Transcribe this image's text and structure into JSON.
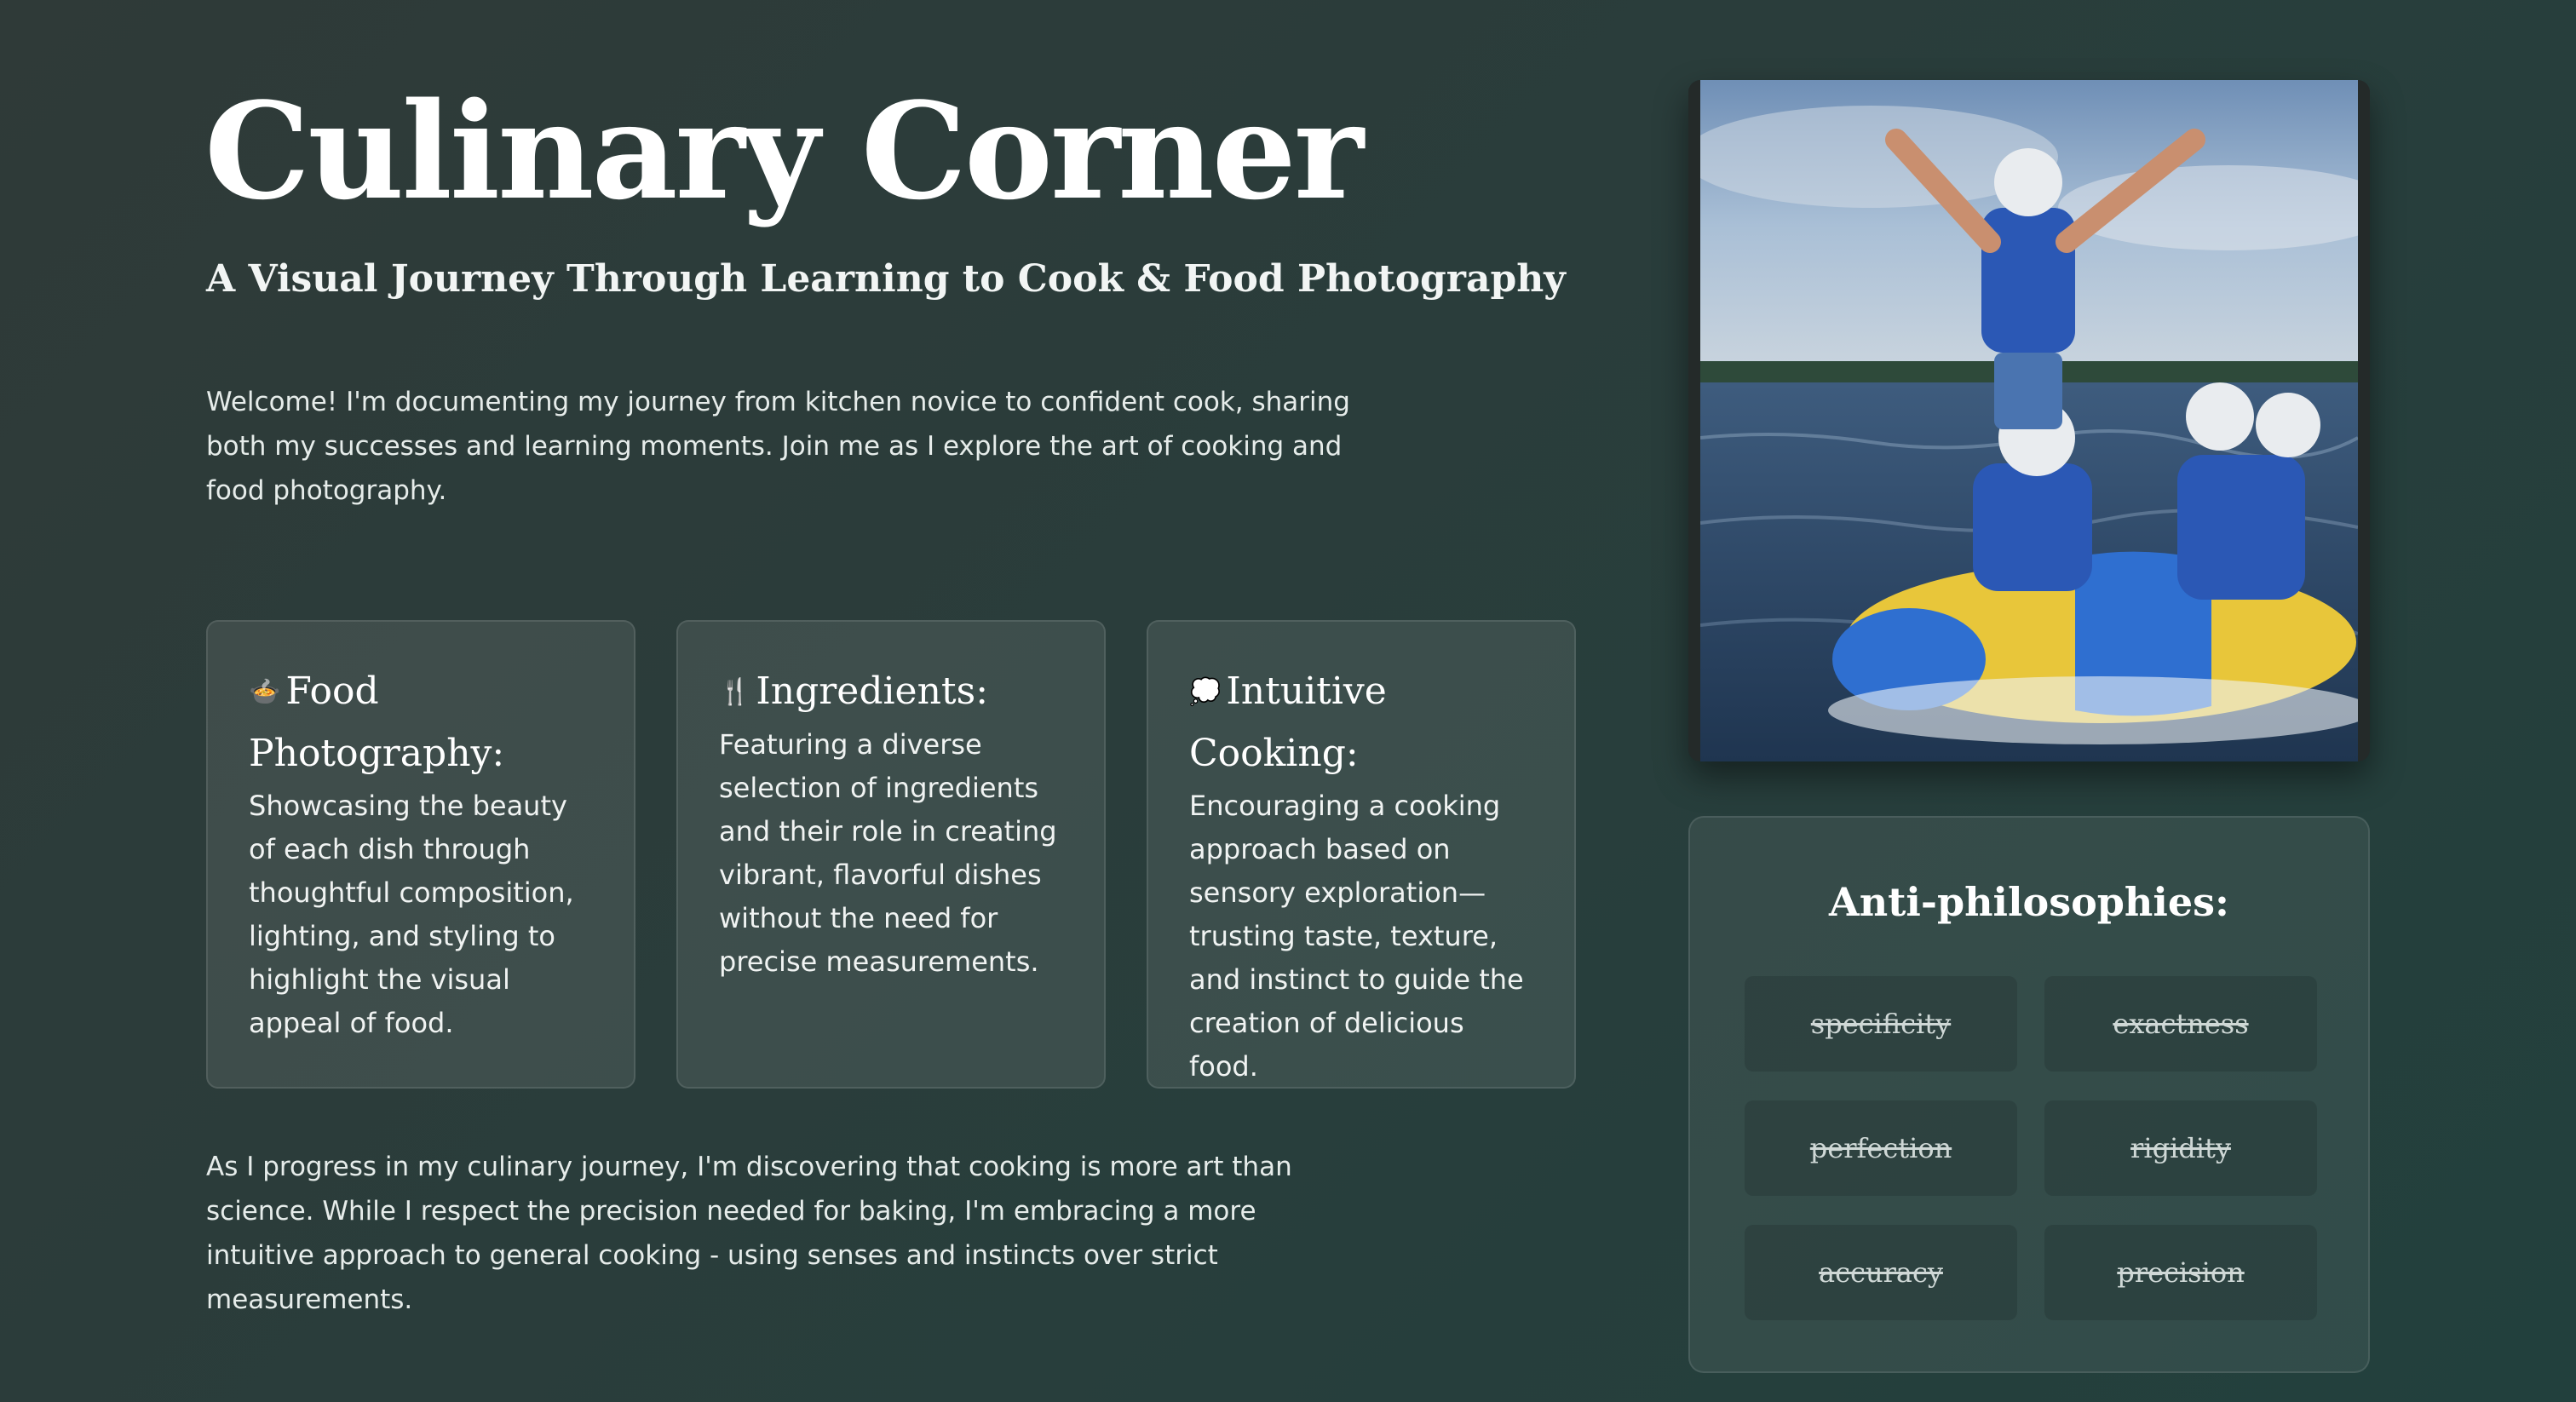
{
  "header": {
    "title": "Culinary Corner",
    "subtitle": "A Visual Journey Through Learning to Cook & Food Photography"
  },
  "intro": "Welcome! I'm documenting my journey from kitchen novice to confident cook, sharing both my successes and learning moments. Join me as I explore the art of cooking and food photography.",
  "cards": [
    {
      "icon": "🍲",
      "icon_name": "food-bowl-icon",
      "heading": "Food Photography:",
      "text": "Showcasing the beauty of each dish through thoughtful composition, lighting, and styling to highlight the visual appeal of food."
    },
    {
      "icon": "🍴",
      "icon_name": "fork-knife-icon",
      "heading": "Ingredients:",
      "text": "Featuring a diverse selection of ingredients and their role in creating vibrant, flavorful dishes without the need for precise measurements."
    },
    {
      "icon": "💭",
      "icon_name": "thought-bubble-icon",
      "heading": "Intuitive Cooking:",
      "text": "Encouraging a cooking approach based on sensory exploration—trusting taste, texture, and instinct to guide the creation of delicious food."
    }
  ],
  "outro": "As I progress in my culinary journey, I'm discovering that cooking is more art than science. While I respect the precision needed for baking, I'm embracing a more intuitive approach to general cooking - using senses and instincts over strict measurements.",
  "anti": {
    "title": "Anti-philosophies:",
    "items": [
      "specificity",
      "exactness",
      "perfection",
      "rigidity",
      "accuracy",
      "precision"
    ]
  },
  "colors": {
    "background_start": "#2f3a38",
    "background_end": "#22403d",
    "raft_blue": "#2f6fd0",
    "raft_yellow": "#e8c63a"
  }
}
